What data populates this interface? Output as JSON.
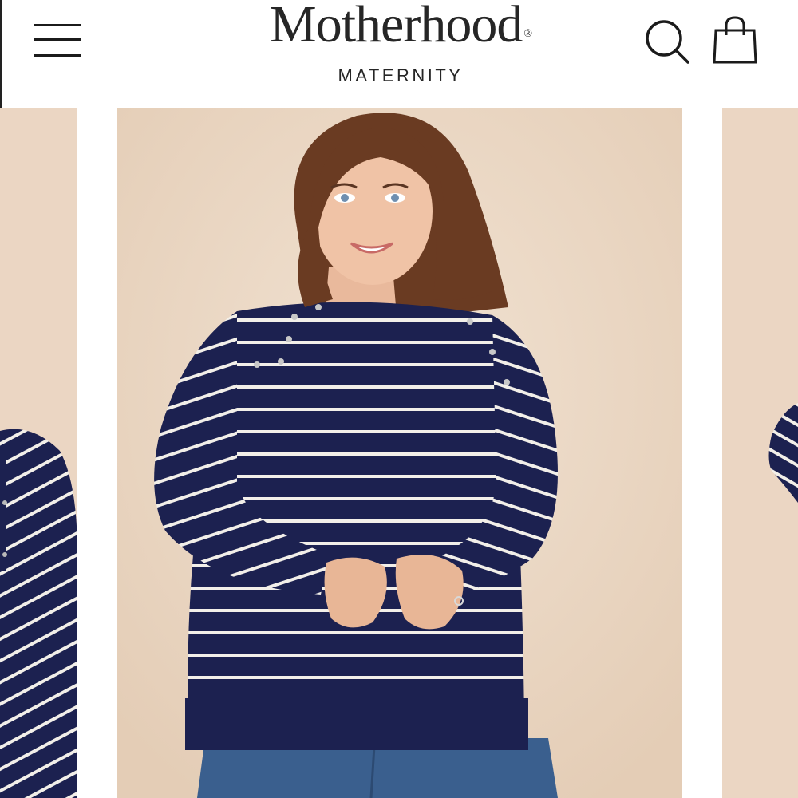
{
  "header": {
    "brand_name": "Motherhood",
    "brand_mark": "®",
    "brand_tagline": "MATERNITY",
    "icons": {
      "menu": "hamburger-menu-icon",
      "search": "search-icon",
      "cart": "shopping-bag-icon"
    }
  },
  "gallery": {
    "slides": [
      {
        "position": "previous",
        "content": "product-photo-striped-sweater-side"
      },
      {
        "position": "current",
        "content": "product-photo-striped-sweater-front"
      },
      {
        "position": "next",
        "content": "product-photo-striped-sweater-back"
      }
    ],
    "colors": {
      "backdrop": "#ecd9c6",
      "sweater_navy": "#1c2150",
      "stripe": "#f2efe9",
      "denim": "#3a5f8e"
    }
  }
}
